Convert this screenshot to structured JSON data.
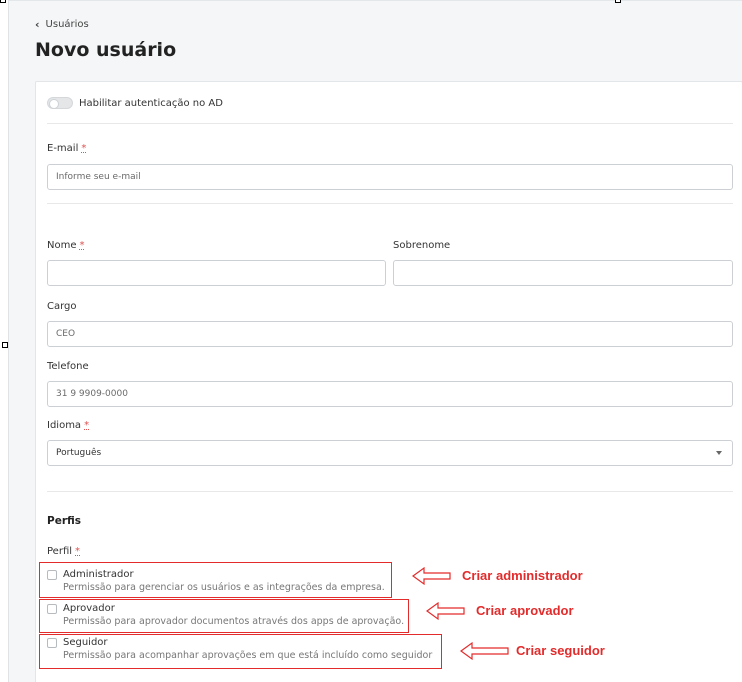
{
  "breadcrumb": {
    "back_label": "Usuários"
  },
  "page": {
    "title": "Novo usuário"
  },
  "form": {
    "ad_toggle_label": "Habilitar autenticação no AD",
    "email": {
      "label": "E-mail",
      "required_mark": "*",
      "placeholder": "Informe seu e-mail"
    },
    "nome": {
      "label": "Nome",
      "required_mark": "*",
      "value": ""
    },
    "sobrenome": {
      "label": "Sobrenome",
      "value": ""
    },
    "cargo": {
      "label": "Cargo",
      "value": "CEO"
    },
    "telefone": {
      "label": "Telefone",
      "value": "31 9 9909-0000"
    },
    "idioma": {
      "label": "Idioma",
      "required_mark": "*",
      "selected": "Português"
    }
  },
  "perfis": {
    "section_title": "Perfis",
    "perfil_label": "Perfil",
    "required_mark": "*",
    "options": [
      {
        "name": "Administrador",
        "description": "Permissão para gerenciar os usuários e as integrações da empresa."
      },
      {
        "name": "Aprovador",
        "description": "Permissão para aprovador documentos através dos apps de aprovação."
      },
      {
        "name": "Seguidor",
        "description": "Permissão para acompanhar aprovações em que está incluído como seguidor"
      }
    ]
  },
  "annotations": {
    "color": "#e32b2b",
    "items": [
      "Criar administrador",
      "Criar aprovador",
      "Criar seguidor"
    ]
  }
}
